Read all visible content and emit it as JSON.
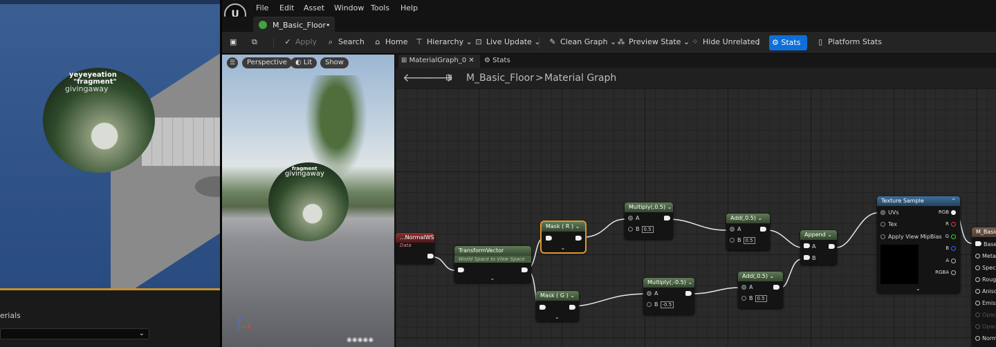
{
  "left_panel": {
    "label": "erials"
  },
  "menu": [
    "File",
    "Edit",
    "Asset",
    "Window",
    "Tools",
    "Help"
  ],
  "document_tab": "M_Basic_Floor•",
  "toolbar": {
    "apply": "Apply",
    "search": "Search",
    "home": "Home",
    "hierarchy": "Hierarchy",
    "live_update": "Live Update",
    "clean_graph": "Clean Graph",
    "preview_state": "Preview State",
    "hide_unrelated": "Hide Unrelated",
    "stats": "Stats",
    "platform_stats": "Platform Stats"
  },
  "preview": {
    "perspective": "Perspective",
    "lit": "Lit",
    "show": "Show",
    "sphere_text_1": "yeyeyeation",
    "sphere_text_2": "\"fragment\"",
    "sphere_text_3": "givingaway",
    "small_sphere_text_1": "fragment",
    "small_sphere_text_2": "givingaway"
  },
  "graph": {
    "tab_graph": "MaterialGraph_0",
    "tab_stats": "Stats",
    "breadcrumb_root": "M_Basic_Floor",
    "breadcrumb_sep": ">",
    "breadcrumb_leaf": "Material Graph"
  },
  "nodes": {
    "normalws": {
      "title": "...NormalWS",
      "sub": "Data"
    },
    "transform": {
      "title": "TransformVector",
      "sub": "World Space to View Space"
    },
    "mask_r": {
      "title": "Mask ( R )"
    },
    "mask_g": {
      "title": "Mask ( G )"
    },
    "multiply1": {
      "title": "Multiply(,0.5)",
      "a": "A",
      "b": "B",
      "b_val": "0.5"
    },
    "multiply2": {
      "title": "Multiply(,-0.5)",
      "a": "A",
      "b": "B",
      "b_val": "-0.5"
    },
    "add1": {
      "title": "Add(,0.5)",
      "a": "A",
      "b": "B",
      "b_val": "0.5"
    },
    "add2": {
      "title": "Add(,0.5)",
      "a": "A",
      "b": "B",
      "b_val": "0.5"
    },
    "append": {
      "title": "Append",
      "a": "A",
      "b": "B"
    },
    "texture": {
      "title": "Texture Sample",
      "uvs": "UVs",
      "tex": "Tex",
      "mip": "Apply View MipBias",
      "rgb": "RGB",
      "r": "R",
      "g": "G",
      "b": "B",
      "a": "A",
      "rgba": "RGBA"
    },
    "result": {
      "title": "M_Basic",
      "pins": [
        "Base C",
        "Metall",
        "Specu",
        "Rough",
        "Aniso",
        "Emiss",
        "Opaci",
        "Opaci",
        "Norm"
      ]
    }
  },
  "colors": {
    "accent_blue": "#0f6fd8",
    "selection_orange": "#e2962b",
    "viewport_gold": "#c8912c"
  }
}
